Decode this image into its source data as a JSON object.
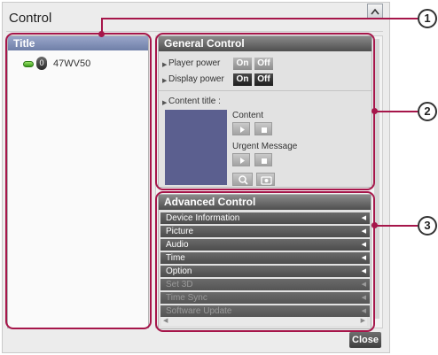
{
  "window": {
    "title": "Control"
  },
  "left_panel": {
    "header": "Title",
    "device": {
      "number": "0",
      "name": "47WV50"
    }
  },
  "general_control": {
    "header": "General Control",
    "rows": [
      {
        "label": "Player power",
        "on": "On",
        "off": "Off",
        "selected": "none"
      },
      {
        "label": "Display power",
        "on": "On",
        "off": "Off",
        "selected": "both"
      }
    ],
    "content_title_label": "Content title :",
    "content_label": "Content",
    "urgent_label": "Urgent Message"
  },
  "advanced_control": {
    "header": "Advanced Control",
    "items": [
      {
        "label": "Device Information",
        "enabled": true
      },
      {
        "label": "Picture",
        "enabled": true
      },
      {
        "label": "Audio",
        "enabled": true
      },
      {
        "label": "Time",
        "enabled": true
      },
      {
        "label": "Option",
        "enabled": true
      },
      {
        "label": "Set 3D",
        "enabled": false
      },
      {
        "label": "Time Sync",
        "enabled": false
      },
      {
        "label": "Software Update",
        "enabled": false
      }
    ]
  },
  "close_label": "Close",
  "callouts": {
    "one": "1",
    "two": "2",
    "three": "3"
  },
  "colors": {
    "callout": "#a6164a",
    "preview": "#5b5f8f",
    "title_bar": "#7f8db3"
  }
}
